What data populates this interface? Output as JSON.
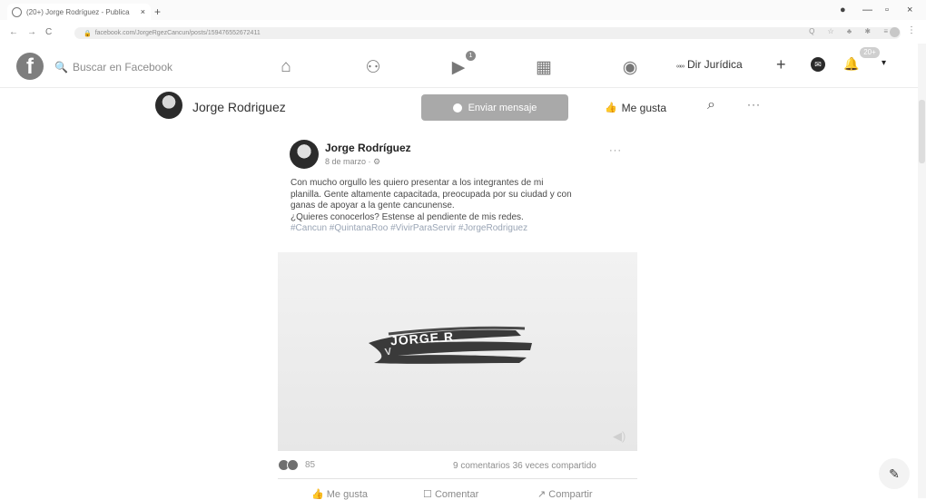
{
  "browser": {
    "tab_title": "(20+) Jorge Rodríguez - Publica",
    "tab_close": "×",
    "new_tab": "+",
    "url": "facebook.com/JorgeRgezCancun/posts/159476552672411",
    "back": "←",
    "forward": "→",
    "reload": "C",
    "lock": "🔒",
    "omni_icons": "Q ☆ ♣ ✱ ≡",
    "menu": "⋮",
    "minimize": "—",
    "maximize": "▫",
    "close": "×",
    "record": "●"
  },
  "fb_header": {
    "logo": "f",
    "search_icon": "🔍",
    "search_placeholder": "Buscar en Facebook",
    "icons": {
      "home": "⌂",
      "friends": "⚇",
      "watch": "▶",
      "marketplace": "▦",
      "groups": "◉"
    },
    "watch_badge": "1",
    "page_switch_mini": "∞∞",
    "page_switch_label": "Dir Jurídica",
    "create": "+",
    "messenger": "✉",
    "notifications": "🔔",
    "notifications_badge": "20+",
    "account": "▾"
  },
  "profile_bar": {
    "name": "Jorge Rodriguez",
    "send_message": "Enviar mensaje",
    "like": "Me gusta",
    "like_icon": "👍",
    "search": "⌕",
    "more": "···"
  },
  "post": {
    "author": "Jorge Rodríguez",
    "date": "8 de marzo · ⚙",
    "more": "···",
    "text_lines": [
      "Con mucho orgullo les quiero presentar a los integrantes de mi",
      "planilla. Gente altamente capacitada, preocupada por su ciudad y con",
      "ganas de apoyar a la gente cancunense.",
      "¿Quieres conocerlos? Estense al pendiente de mis redes."
    ],
    "hashtags": "#Cancun #QuintanaRoo #VivirParaServir #JorgeRodriguez",
    "media_text_1": "JORGE R",
    "media_text_2": "V",
    "volume": "◀)",
    "reaction_count": "85",
    "stats": "9 comentarios  36 veces compartido",
    "actions": {
      "like": "Me gusta",
      "comment": "Comentar",
      "share": "Compartir"
    },
    "action_icons": {
      "like": "👍",
      "comment": "☐",
      "share": "↗"
    }
  },
  "compose_icon": "✎"
}
